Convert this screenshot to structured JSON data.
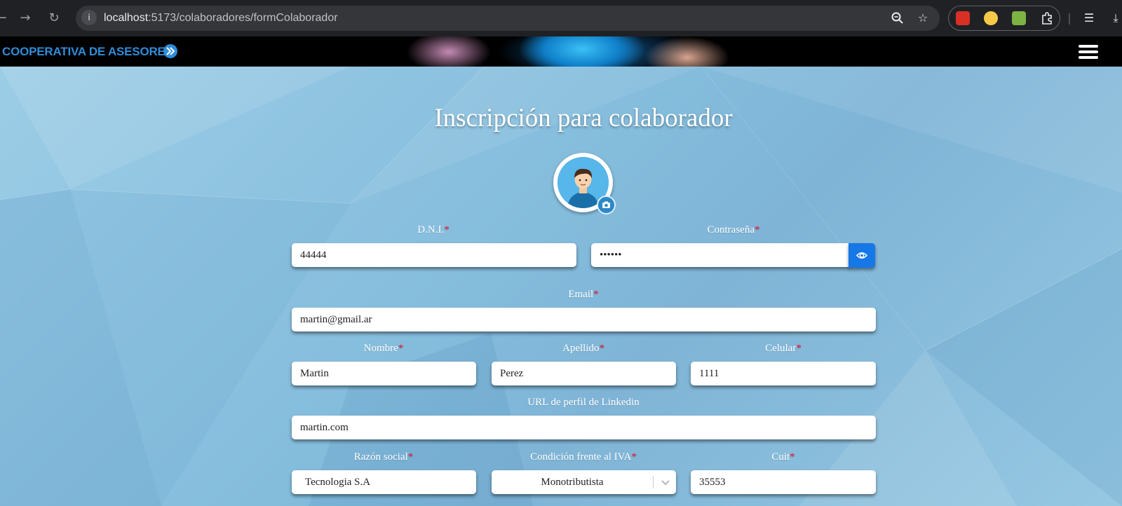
{
  "browser": {
    "url_host": "localhost",
    "url_path": ":5173/colaboradores/formColaborador"
  },
  "header": {
    "brand": "COOPERATIVA DE ASESORES"
  },
  "form": {
    "title": "Inscripción para colaborador",
    "fields": {
      "dni": {
        "label": "D.N.I.",
        "required": "*",
        "value": "44444"
      },
      "password": {
        "label": "Contraseña",
        "required": "*",
        "value": "••••••"
      },
      "email": {
        "label": "Email",
        "required": "*",
        "value": "martin@gmail.ar"
      },
      "nombre": {
        "label": "Nombre",
        "required": "*",
        "value": "Martin"
      },
      "apellido": {
        "label": "Apellido",
        "required": "*",
        "value": "Perez"
      },
      "celular": {
        "label": "Celular",
        "required": "*",
        "value": "1111"
      },
      "linkedin": {
        "label": "URL de perfil de Linkedin",
        "value": "martin.com"
      },
      "razon_social": {
        "label": "Razón social",
        "required": "*",
        "value": "Tecnologia S.A"
      },
      "iva": {
        "label": "Condición frente al IVA",
        "required": "*",
        "value": "Monotributista"
      },
      "cuit": {
        "label": "Cuit",
        "required": "*",
        "value": "35553"
      }
    }
  },
  "colors": {
    "accent": "#1677e6",
    "required": "#e8112d",
    "background": "#8fc3de"
  },
  "icons": [
    "back-icon",
    "forward-icon",
    "reload-icon",
    "info-icon",
    "zoom-icon",
    "star-icon",
    "extensions-icon",
    "media-icon",
    "download-icon",
    "menu-icon",
    "camera-icon",
    "eye-icon",
    "chevron-down-icon"
  ]
}
